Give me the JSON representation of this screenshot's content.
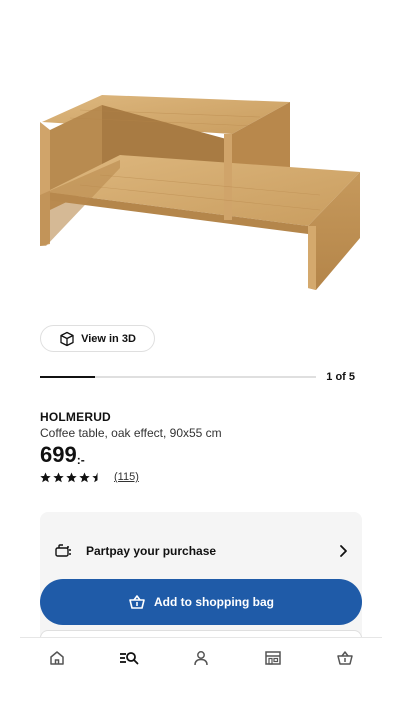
{
  "product": {
    "image_alt_icon": "coffee-table-image",
    "view_3d_label": "View in 3D",
    "carousel": {
      "current": 1,
      "total": 5,
      "label": "1 of 5"
    },
    "name": "HOLMERUD",
    "description": "Coffee table, oak effect, 90x55 cm",
    "price": {
      "integer": "699",
      "suffix": ":-"
    },
    "rating": {
      "value": 4.5,
      "max": 5,
      "review_count": "(115)"
    }
  },
  "purchase": {
    "partpay_label": "Partpay your purchase",
    "add_to_bag_label": "Add to shopping bag"
  },
  "bottom_nav": {
    "items": [
      {
        "icon": "home-icon",
        "active": false
      },
      {
        "icon": "search-list-icon",
        "active": true
      },
      {
        "icon": "profile-icon",
        "active": false
      },
      {
        "icon": "store-icon",
        "active": false
      },
      {
        "icon": "shopping-bag-icon",
        "active": false
      }
    ]
  },
  "colors": {
    "primary_button": "#1f5ba8",
    "card_background": "#f5f5f5",
    "text": "#111111"
  }
}
